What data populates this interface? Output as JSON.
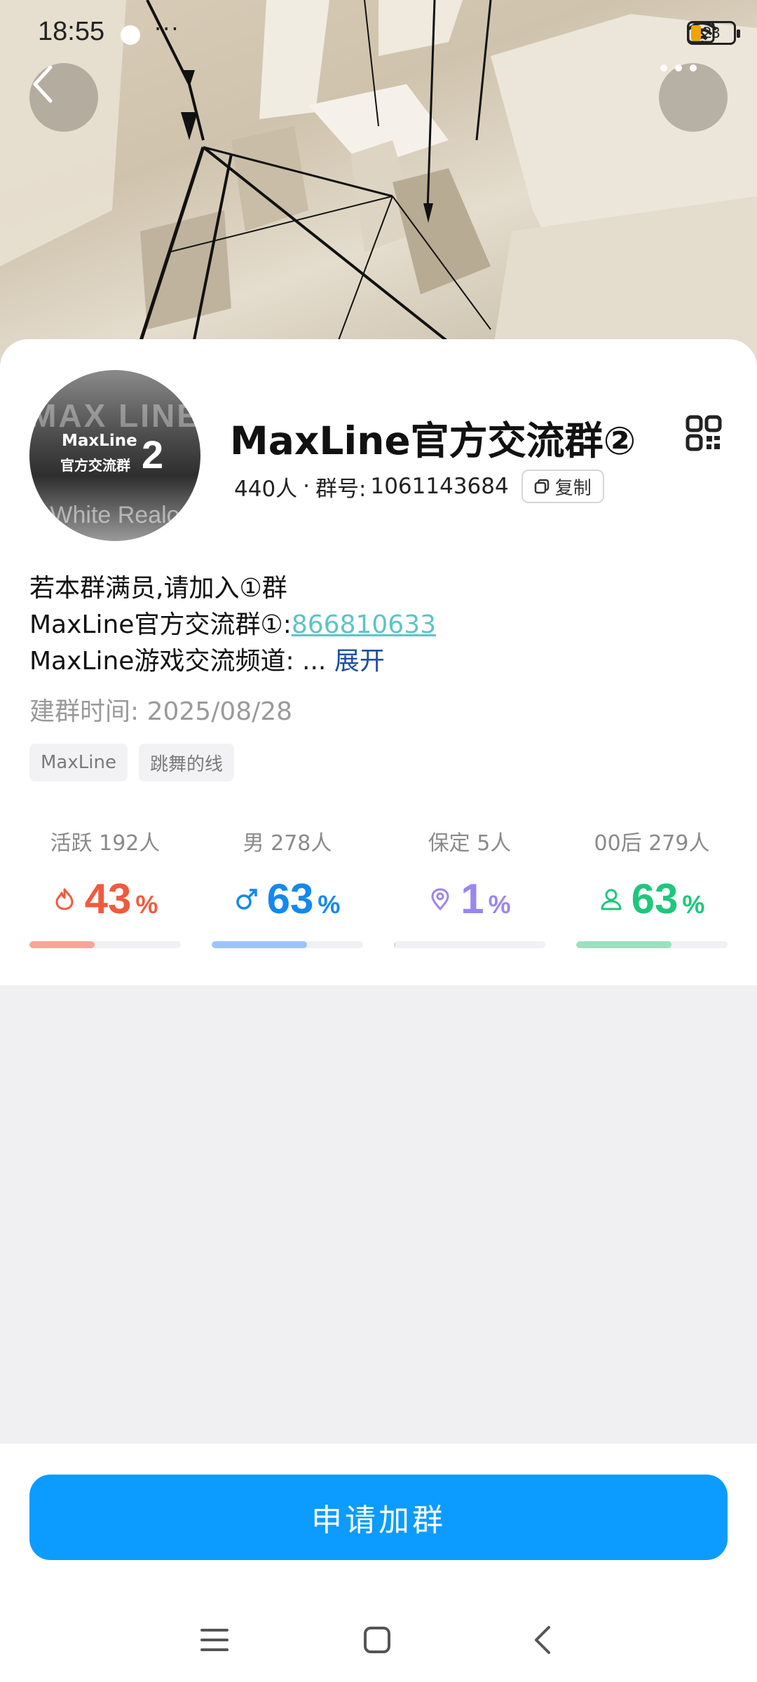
{
  "status_bar": {
    "time": "18:55",
    "battery": "23"
  },
  "group": {
    "name": "MaxLine官方交流群②",
    "members": "440人",
    "separator": "·",
    "id_label": "群号:",
    "id": "1061143684",
    "copy_label": "复制"
  },
  "avatar": {
    "top_text": "MAX LINE",
    "brand": "MaxLine",
    "sub": "官方交流群",
    "num": "2",
    "bottom_text": "White Realo"
  },
  "description": {
    "line1": "若本群满员,请加入①群",
    "line2_prefix": "MaxLine官方交流群①:",
    "line2_link": "866810633",
    "line3_prefix": "MaxLine游戏交流频道:",
    "line3_ellipsis": "...",
    "expand_label": "展开"
  },
  "created": {
    "label": "建群时间:",
    "date": "2025/08/28"
  },
  "tags": [
    "MaxLine",
    "跳舞的线"
  ],
  "stats": [
    {
      "label": "活跃 192人",
      "value": "43",
      "unit": "%",
      "icon": "flame-icon",
      "color": "#f05a3d",
      "bar_color": "#f6a697",
      "fraction": 0.43
    },
    {
      "label": "男 278人",
      "value": "63",
      "unit": "%",
      "icon": "male-icon",
      "color": "#1389ee",
      "bar_color": "#9ac5fb",
      "fraction": 0.63
    },
    {
      "label": "保定 5人",
      "value": "1",
      "unit": "%",
      "icon": "location-pin-icon",
      "color": "#9a86ee",
      "bar_color": "#d4d4d8",
      "fraction": 0.01
    },
    {
      "label": "00后 279人",
      "value": "63",
      "unit": "%",
      "icon": "person-icon",
      "color": "#1ec77c",
      "bar_color": "#9ce0bf",
      "fraction": 0.63
    }
  ],
  "join_button": "申请加群"
}
